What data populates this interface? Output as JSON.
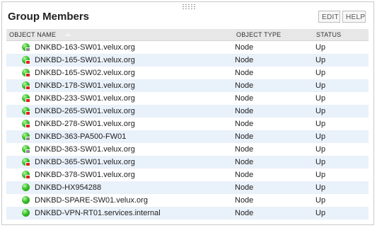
{
  "panel": {
    "title": "Group Members",
    "edit_label": "EDIT",
    "help_label": "HELP"
  },
  "table": {
    "columns": {
      "name": "OBJECT NAME",
      "type": "OBJECT TYPE",
      "status": "STATUS"
    },
    "rows": [
      {
        "name": "DNKBD-163-SW01.velux.org",
        "type": "Node",
        "status": "Up",
        "icon": "node-up-gray-badge-icon",
        "badge": "gray"
      },
      {
        "name": "DNKBD-165-SW01.velux.org",
        "type": "Node",
        "status": "Up",
        "icon": "node-up-red-badge-icon",
        "badge": "red"
      },
      {
        "name": "DNKBD-165-SW02.velux.org",
        "type": "Node",
        "status": "Up",
        "icon": "node-up-red-badge-icon",
        "badge": "red"
      },
      {
        "name": "DNKBD-178-SW01.velux.org",
        "type": "Node",
        "status": "Up",
        "icon": "node-up-red-badge-icon",
        "badge": "red"
      },
      {
        "name": "DNKBD-233-SW01.velux.org",
        "type": "Node",
        "status": "Up",
        "icon": "node-up-red-badge-icon",
        "badge": "red"
      },
      {
        "name": "DNKBD-265-SW01.velux.org",
        "type": "Node",
        "status": "Up",
        "icon": "node-up-red-badge-icon",
        "badge": "red"
      },
      {
        "name": "DNKBD-278-SW01.velux.org",
        "type": "Node",
        "status": "Up",
        "icon": "node-up-red-badge-icon",
        "badge": "red"
      },
      {
        "name": "DNKBD-363-PA500-FW01",
        "type": "Node",
        "status": "Up",
        "icon": "node-up-gray-badge-icon",
        "badge": "gray"
      },
      {
        "name": "DNKBD-363-SW01.velux.org",
        "type": "Node",
        "status": "Up",
        "icon": "node-up-gray-badge-icon",
        "badge": "gray"
      },
      {
        "name": "DNKBD-365-SW01.velux.org",
        "type": "Node",
        "status": "Up",
        "icon": "node-up-red-badge-icon",
        "badge": "red"
      },
      {
        "name": "DNKBD-378-SW01.velux.org",
        "type": "Node",
        "status": "Up",
        "icon": "node-up-red-badge-icon",
        "badge": "red"
      },
      {
        "name": "DNKBD-HX954288",
        "type": "Node",
        "status": "Up",
        "icon": "node-up-icon",
        "badge": "none"
      },
      {
        "name": "DNKBD-SPARE-SW01.velux.org",
        "type": "Node",
        "status": "Up",
        "icon": "node-up-icon",
        "badge": "none"
      },
      {
        "name": "DNKBD-VPN-RT01.services.internal",
        "type": "Node",
        "status": "Up",
        "icon": "node-up-icon",
        "badge": "none"
      }
    ]
  },
  "colors": {
    "header_bg": "#e7e7e7",
    "alt_row_bg": "#e9f1fa",
    "status_up": "#38c128",
    "badge_red": "#e02020",
    "badge_gray": "#8a8a8a"
  }
}
